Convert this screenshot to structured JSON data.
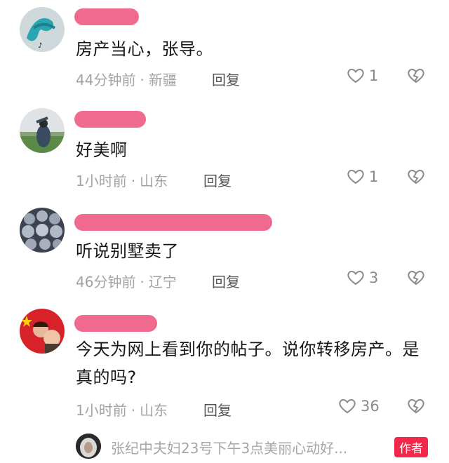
{
  "colors": {
    "name_mask": "#f06a90",
    "meta_gray": "#a3a3a3",
    "author_badge": "#f2294b"
  },
  "icons": {
    "like": "heart-outline-icon",
    "dislike": "broken-heart-icon"
  },
  "comments": [
    {
      "text": "房产当心，张导。",
      "time": "44分钟前",
      "location": "新疆",
      "reply": "回复",
      "likes": "1"
    },
    {
      "text": "好美啊",
      "time": "1小时前",
      "location": "山东",
      "reply": "回复",
      "likes": "1"
    },
    {
      "text": "听说别墅卖了",
      "time": "46分钟前",
      "location": "辽宁",
      "reply": "回复",
      "likes": "3"
    },
    {
      "text": "今天为网上看到你的帖子。说你转移房产。是真的吗?",
      "time": "1小时前",
      "location": "山东",
      "reply": "回复",
      "likes": "36"
    }
  ],
  "dot": "·",
  "author_reply": {
    "preview": "张纪中夫妇23号下午3点美丽心动好...",
    "badge": "作者"
  }
}
